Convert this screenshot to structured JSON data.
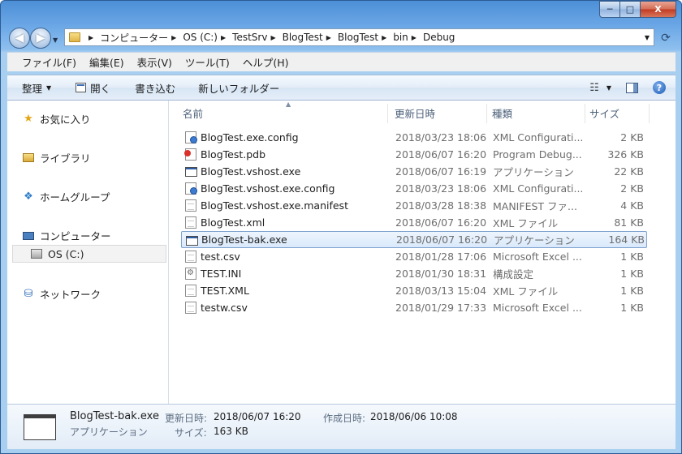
{
  "window": {
    "caption_buttons": {
      "minimize": "─",
      "maximize": "□",
      "close": "X"
    }
  },
  "address": {
    "crumbs": [
      "コンピューター",
      "OS (C:)",
      "TestSrv",
      "BlogTest",
      "BlogTest",
      "bin",
      "Debug"
    ]
  },
  "menu": [
    "ファイル(F)",
    "編集(E)",
    "表示(V)",
    "ツール(T)",
    "ヘルプ(H)"
  ],
  "toolbar": {
    "organize": "整理",
    "open": "開く",
    "burn": "書き込む",
    "new_folder": "新しいフォルダー"
  },
  "nav": {
    "favorites": "お気に入り",
    "libraries": "ライブラリ",
    "homegroup": "ホームグループ",
    "computer": "コンピューター",
    "drive": "OS (C:)",
    "network": "ネットワーク"
  },
  "columns": {
    "name": "名前",
    "date": "更新日時",
    "type": "種類",
    "size": "サイズ"
  },
  "files": [
    {
      "name": "BlogTest.exe.config",
      "date": "2018/03/23 18:06",
      "type": "XML Configurati...",
      "size": "2 KB",
      "icon": "config-icon",
      "selected": false
    },
    {
      "name": "BlogTest.pdb",
      "date": "2018/06/07 16:20",
      "type": "Program Debug...",
      "size": "326 KB",
      "icon": "pdb-icon",
      "selected": false
    },
    {
      "name": "BlogTest.vshost.exe",
      "date": "2018/06/07 16:19",
      "type": "アプリケーション",
      "size": "22 KB",
      "icon": "exe-icon",
      "selected": false
    },
    {
      "name": "BlogTest.vshost.exe.config",
      "date": "2018/03/23 18:06",
      "type": "XML Configurati...",
      "size": "2 KB",
      "icon": "config-icon",
      "selected": false
    },
    {
      "name": "BlogTest.vshost.exe.manifest",
      "date": "2018/03/28 18:38",
      "type": "MANIFEST ファ...",
      "size": "4 KB",
      "icon": "document-icon",
      "selected": false
    },
    {
      "name": "BlogTest.xml",
      "date": "2018/06/07 16:20",
      "type": "XML ファイル",
      "size": "81 KB",
      "icon": "document-icon",
      "selected": false
    },
    {
      "name": "BlogTest-bak.exe",
      "date": "2018/06/07 16:20",
      "type": "アプリケーション",
      "size": "164 KB",
      "icon": "exe-icon",
      "selected": true
    },
    {
      "name": "test.csv",
      "date": "2018/01/28 17:06",
      "type": "Microsoft Excel ...",
      "size": "1 KB",
      "icon": "document-icon",
      "selected": false
    },
    {
      "name": "TEST.INI",
      "date": "2018/01/30 18:31",
      "type": "構成設定",
      "size": "1 KB",
      "icon": "settings-file-icon",
      "selected": false
    },
    {
      "name": "TEST.XML",
      "date": "2018/03/13 15:04",
      "type": "XML ファイル",
      "size": "1 KB",
      "icon": "document-icon",
      "selected": false
    },
    {
      "name": "testw.csv",
      "date": "2018/01/29 17:33",
      "type": "Microsoft Excel ...",
      "size": "1 KB",
      "icon": "document-icon",
      "selected": false
    }
  ],
  "details": {
    "filename": "BlogTest-bak.exe",
    "type": "アプリケーション",
    "modified_label": "更新日時:",
    "modified": "2018/06/07 16:20",
    "created_label": "作成日時:",
    "created": "2018/06/06 10:08",
    "size_label": "サイズ:",
    "size": "163 KB"
  }
}
